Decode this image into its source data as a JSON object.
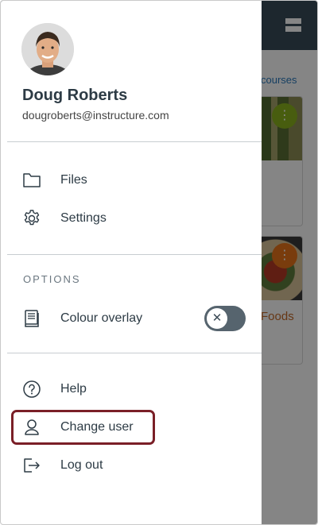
{
  "background": {
    "link_text": "courses",
    "card_more_glyph": "⋮",
    "card2_title": "Foods"
  },
  "user": {
    "name": "Doug Roberts",
    "email": "dougroberts@instructure.com"
  },
  "menu_top": [
    {
      "label": "Files",
      "icon": "folder-icon"
    },
    {
      "label": "Settings",
      "icon": "gear-icon"
    }
  ],
  "options": {
    "title": "OPTIONS",
    "colour_overlay_label": "Colour overlay",
    "colour_overlay_enabled": false,
    "toggle_glyph": "✕"
  },
  "menu_bottom": [
    {
      "label": "Help",
      "icon": "help-icon"
    },
    {
      "label": "Change user",
      "icon": "user-icon",
      "highlighted": true
    },
    {
      "label": "Log out",
      "icon": "logout-icon"
    }
  ],
  "colors": {
    "topbar": "#394b58",
    "text": "#2d3b45",
    "highlight_border": "#7a1f27"
  }
}
